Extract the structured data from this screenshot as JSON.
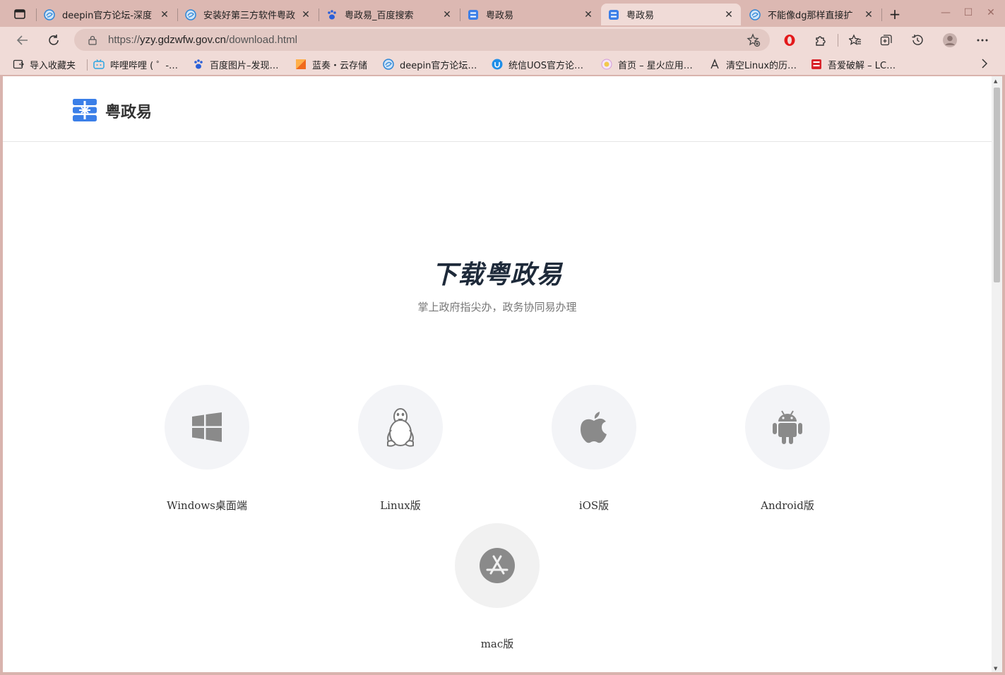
{
  "browser": {
    "tabs": [
      {
        "title": "deepin官方论坛-深度",
        "icon": "deepin-icon",
        "active": false
      },
      {
        "title": "安装好第三方软件粤政",
        "icon": "deepin-icon",
        "active": false
      },
      {
        "title": "粤政易_百度搜索",
        "icon": "baidu-paw-icon",
        "active": false
      },
      {
        "title": "粤政易",
        "icon": "yzy-icon",
        "active": false
      },
      {
        "title": "粤政易",
        "icon": "yzy-icon",
        "active": true
      },
      {
        "title": "不能像dg那样直接扩",
        "icon": "deepin-icon",
        "active": false
      }
    ],
    "close_glyph": "✕",
    "new_tab_glyph": "+",
    "window_controls": {
      "minimize": "—",
      "maximize": "☐",
      "close": "✕"
    },
    "address": {
      "scheme": "https://",
      "host": "yzy.gdzwfw.gov.cn",
      "path": "/download.html"
    },
    "bookmarks": [
      {
        "label": "导入收藏夹",
        "icon": "import-icon"
      },
      {
        "label": "哔哩哔哩 ( ゜-…",
        "icon": "bilibili-icon"
      },
      {
        "label": "百度图片–发现…",
        "icon": "baidu-paw-icon"
      },
      {
        "label": "蓝奏・云存储",
        "icon": "lanzou-icon"
      },
      {
        "label": "deepin官方论坛…",
        "icon": "deepin-icon"
      },
      {
        "label": "统信UOS官方论…",
        "icon": "uos-icon"
      },
      {
        "label": "首页 – 星火应用…",
        "icon": "spark-icon"
      },
      {
        "label": "清空Linux的历…",
        "icon": "rocket-icon"
      },
      {
        "label": "吾爱破解 – LC…",
        "icon": "52pojie-icon"
      }
    ],
    "colors": {
      "frame": "#dcb8b2",
      "toolbar": "#f0dbd7",
      "address_bg": "#e3c9c4"
    }
  },
  "page": {
    "site_name": "粤政易",
    "title": "下载粤政易",
    "subtitle": "掌上政府指尖办，政务协同易办理",
    "downloads": [
      {
        "label": "Windows桌面端",
        "icon": "windows-icon"
      },
      {
        "label": "Linux版",
        "icon": "linux-tux-icon"
      },
      {
        "label": "iOS版",
        "icon": "apple-icon"
      },
      {
        "label": "Android版",
        "icon": "android-icon"
      },
      {
        "label": "mac版",
        "icon": "app-store-icon"
      }
    ],
    "colors": {
      "brand": "#3b7fe8",
      "title": "#1e2a3a",
      "circle_bg": "#f3f4f7",
      "icon_gray": "#8a8a8a"
    }
  }
}
